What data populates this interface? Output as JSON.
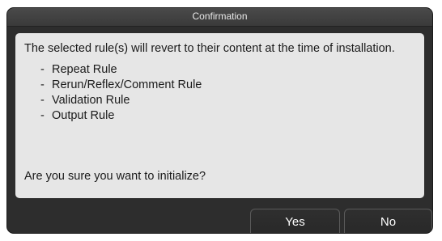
{
  "dialog": {
    "title": "Confirmation",
    "message": "The selected rule(s) will revert to their content at the time of installation.",
    "rules": [
      "Repeat Rule",
      "Rerun/Reflex/Comment Rule",
      "Validation Rule",
      "Output Rule"
    ],
    "rule_prefix": "-",
    "question": "Are you sure you want to initialize?",
    "yes_label": "Yes",
    "no_label": "No"
  }
}
